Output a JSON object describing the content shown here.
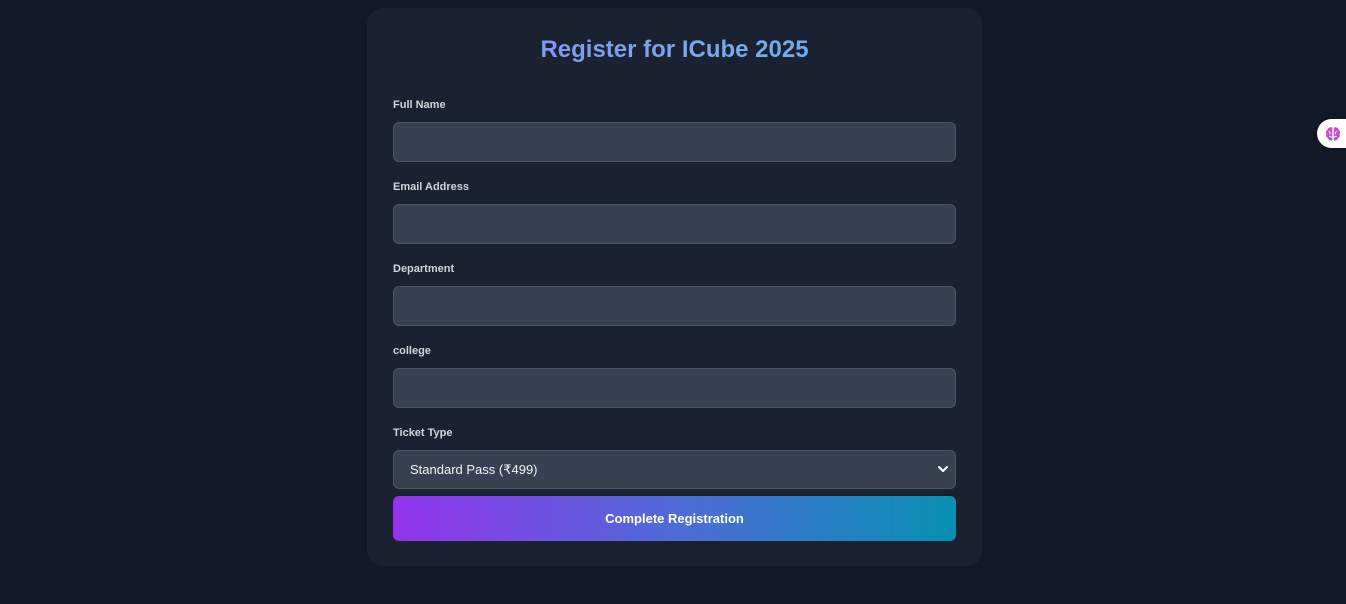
{
  "form": {
    "title": "Register for ICube 2025",
    "fields": [
      {
        "label": "Full Name",
        "value": "",
        "placeholder": ""
      },
      {
        "label": "Email Address",
        "value": "",
        "placeholder": ""
      },
      {
        "label": "Department",
        "value": "",
        "placeholder": ""
      },
      {
        "label": "college",
        "value": "",
        "placeholder": ""
      }
    ],
    "ticket": {
      "label": "Ticket Type",
      "selected": "Standard Pass (₹499)",
      "icon": "chevron-down-icon"
    },
    "submit_label": "Complete Registration"
  },
  "extension": {
    "icon": "brain-icon"
  },
  "colors": {
    "background": "#111827",
    "card": "#1a2130",
    "input_bg": "#374151",
    "gradient_start": "#9333ea",
    "gradient_end": "#0891b2",
    "title_gradient_start": "#818cf8",
    "title_gradient_end": "#5ab6f0"
  }
}
